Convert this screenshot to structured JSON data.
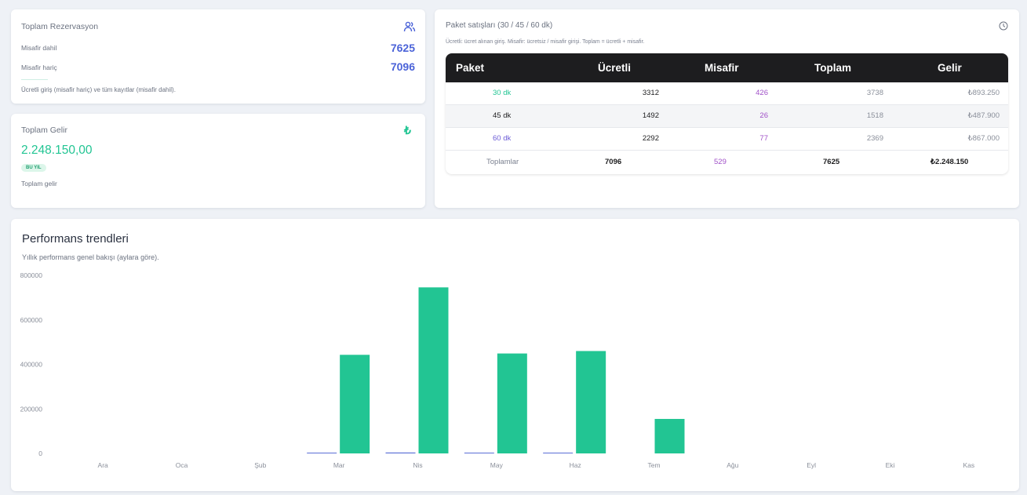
{
  "reservations": {
    "title": "Toplam Rezervasyon",
    "with_guest_label": "Misafir dahil",
    "with_guest_value": "7625",
    "without_guest_label": "Misafir hariç",
    "without_guest_value": "7096",
    "footnote": "Ücretli giriş (misafir hariç) ve tüm kayıtlar (misafir dahil).",
    "icon": "users-icon",
    "accent": "#4b63d8"
  },
  "revenue": {
    "title": "Toplam Gelir",
    "amount": "2.248.150,00",
    "badge": "BU YIL",
    "footnote": "Toplam gelir",
    "icon": "lira-icon",
    "icon_glyph": "₺",
    "accent": "#22c593"
  },
  "packages": {
    "title": "Paket satışları (30 / 45 / 60 dk)",
    "note": "Ücretli: ücret alınan giriş. Misafir: ücretsiz / misafir girişi. Toplam = ücretli + misafir.",
    "icon": "clock-icon",
    "headers": [
      "Paket",
      "Ücretli",
      "Misafir",
      "Toplam",
      "Gelir"
    ],
    "rows": [
      {
        "package": "30 dk",
        "paid": "3312",
        "guest": "426",
        "total": "3738",
        "revenue": "₺893.250",
        "color": "#22c593"
      },
      {
        "package": "45 dk",
        "paid": "1492",
        "guest": "26",
        "total": "1518",
        "revenue": "₺487.900",
        "color": "#1d1d1f"
      },
      {
        "package": "60 dk",
        "paid": "2292",
        "guest": "77",
        "total": "2369",
        "revenue": "₺867.000",
        "color": "#6b5bd6"
      }
    ],
    "totals": {
      "label": "Toplamlar",
      "paid": "7096",
      "guest": "529",
      "total": "7625",
      "revenue": "₺2.248.150"
    },
    "guest_color": "#a050c8"
  },
  "performance": {
    "title": "Performans trendleri",
    "subtitle": "Yıllık performans genel bakışı (aylara göre)."
  },
  "chart_data": {
    "type": "bar",
    "categories": [
      "Ara",
      "Oca",
      "Şub",
      "Mar",
      "Nis",
      "May",
      "Haz",
      "Tem",
      "Ağu",
      "Eyl",
      "Eki",
      "Kas"
    ],
    "series": [
      {
        "values": [
          0,
          0,
          0,
          3396,
          4100,
          2300,
          3400,
          0,
          0,
          0,
          0,
          0
        ],
        "color": "#5b6fd6"
      },
      {
        "values": [
          0,
          0,
          0,
          443000,
          746000,
          449000,
          460000,
          155000,
          0,
          0,
          0,
          0
        ],
        "color": "#22c593"
      }
    ],
    "yticks": [
      0,
      200000,
      400000,
      600000,
      800000
    ],
    "ylim": [
      0,
      800000
    ],
    "grid": false,
    "legend": "none"
  }
}
